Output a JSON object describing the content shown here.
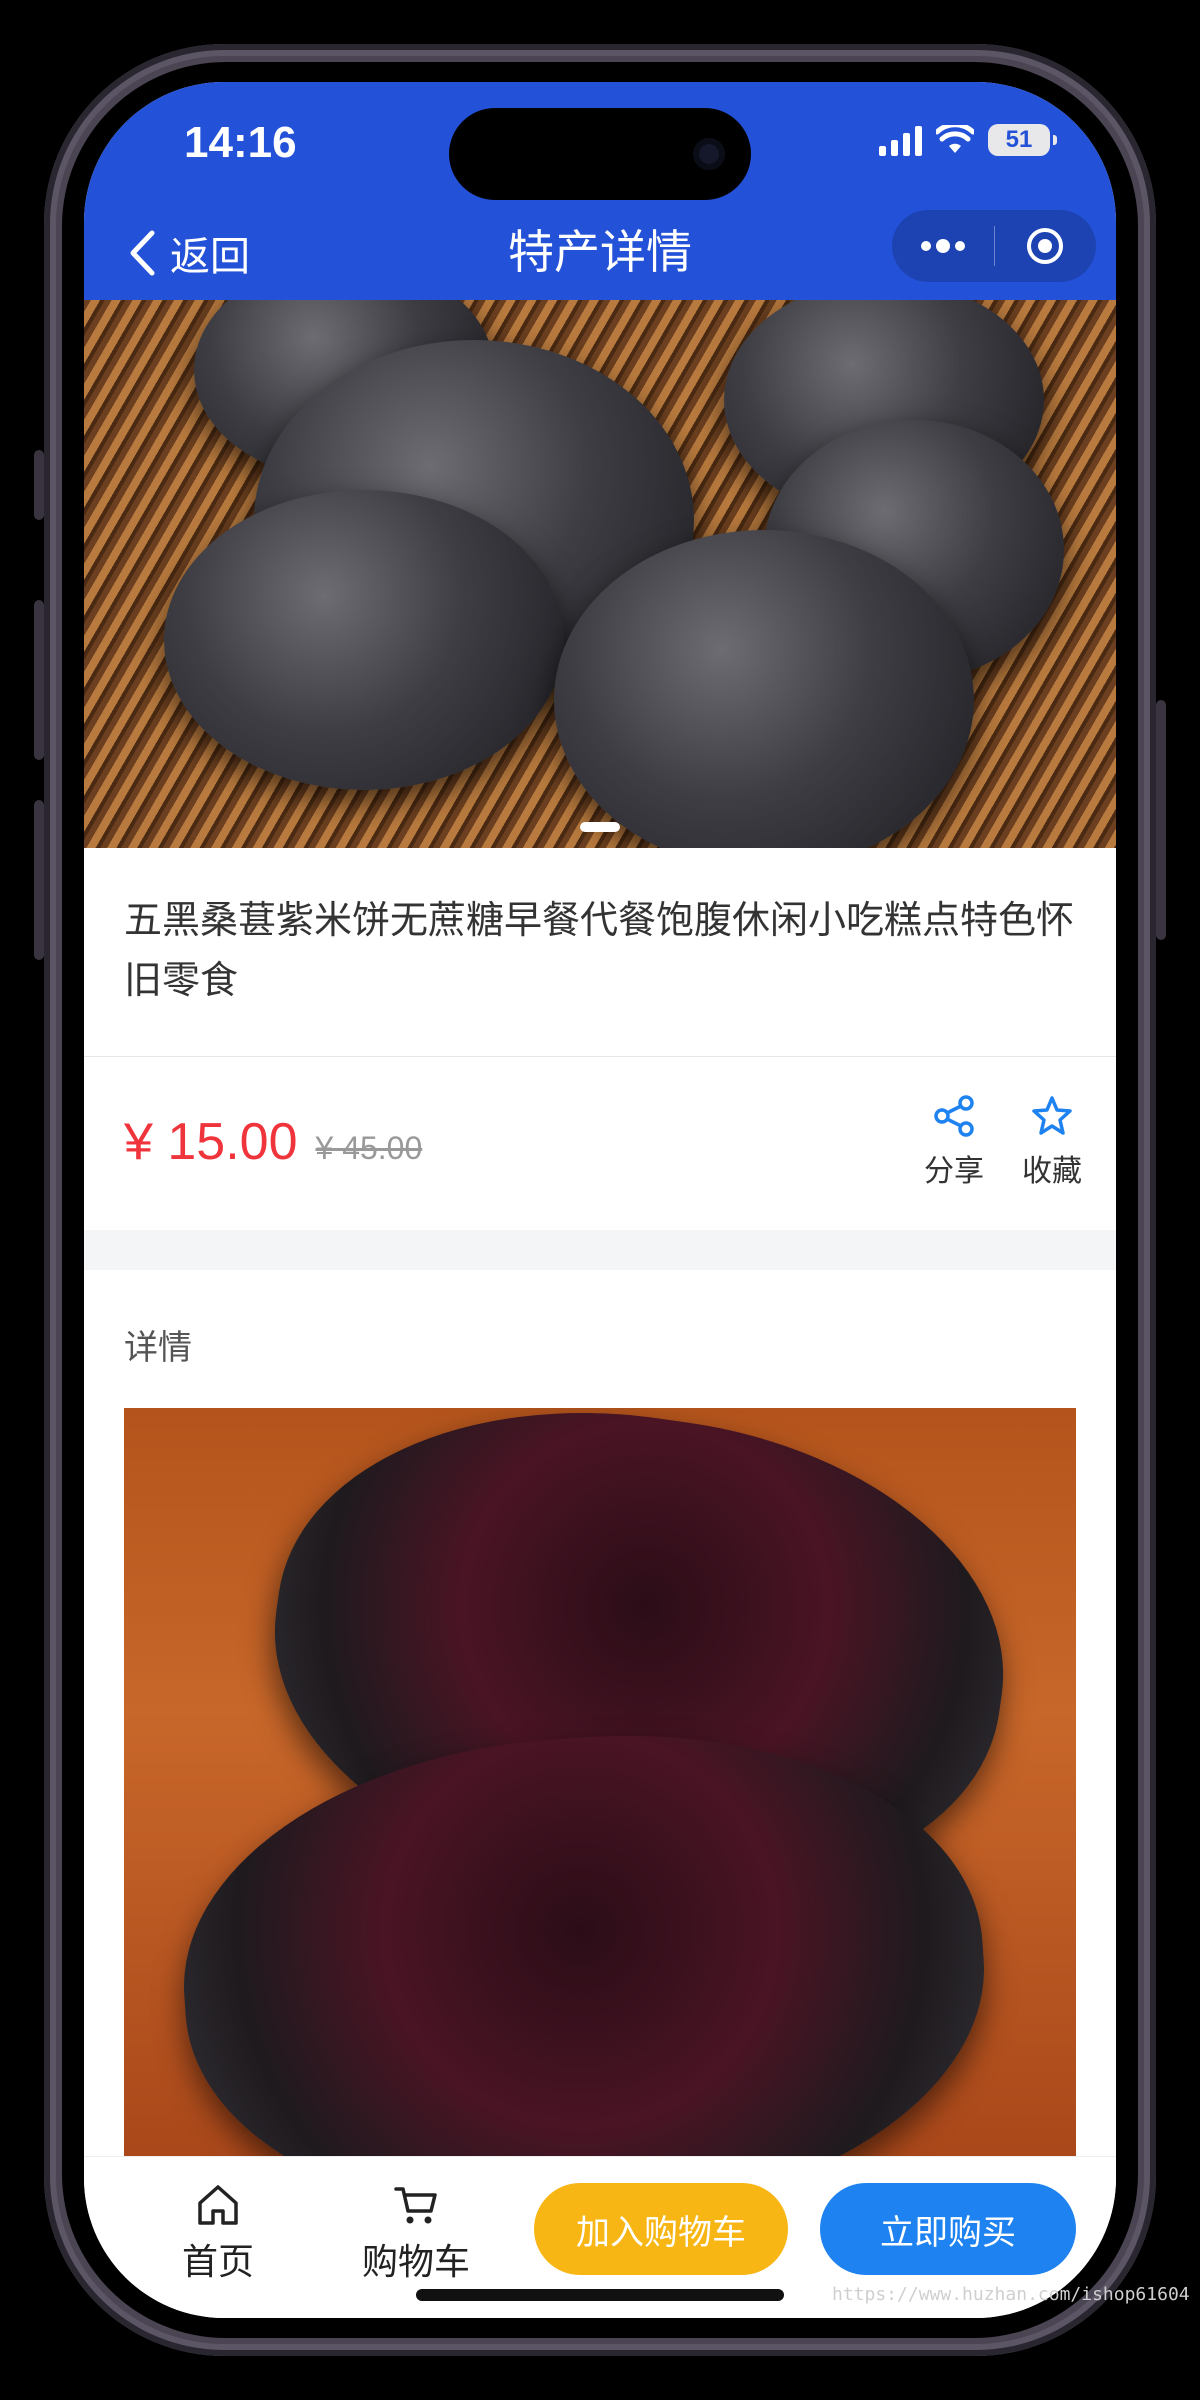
{
  "status": {
    "time": "14:16",
    "battery": "51"
  },
  "nav": {
    "back_label": "返回",
    "title": "特产详情"
  },
  "product": {
    "title": "五黑桑葚紫米饼无蔗糖早餐代餐饱腹休闲小吃糕点特色怀旧零食",
    "price": "¥ 15.00",
    "original_price": "¥ 45.00"
  },
  "actions": {
    "share_label": "分享",
    "favorite_label": "收藏"
  },
  "detail": {
    "label": "详情"
  },
  "bottom": {
    "home_label": "首页",
    "cart_label": "购物车",
    "add_to_cart": "加入购物车",
    "buy_now": "立即购买"
  },
  "watermark": "https://www.huzhan.com/ishop61604",
  "colors": {
    "nav": "#2352d8",
    "price": "#f0343c",
    "cart_button": "#f7b614",
    "buy_button": "#1e83f0"
  },
  "icons": [
    "back-chevron-icon",
    "more-icon",
    "target-icon",
    "share-icon",
    "star-icon",
    "home-icon",
    "cart-icon"
  ]
}
